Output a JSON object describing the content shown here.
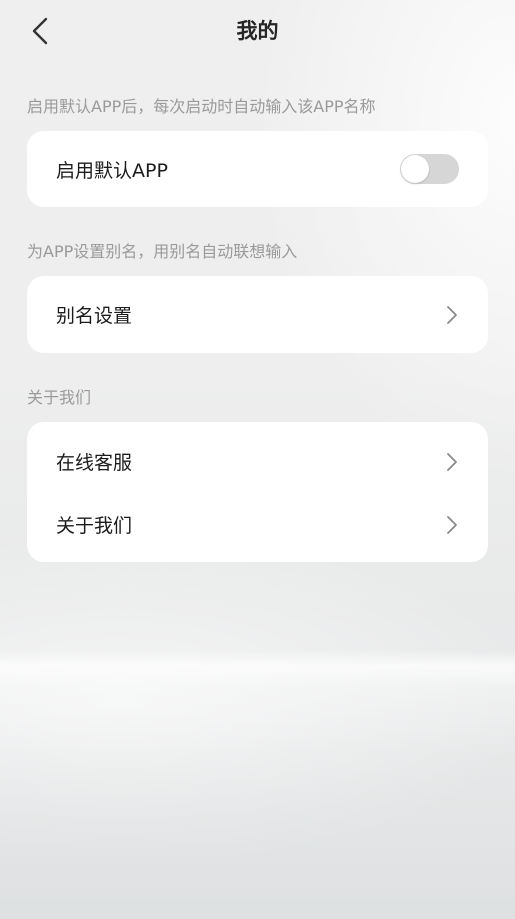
{
  "header": {
    "title": "我的",
    "back_icon": "chevron-left-icon"
  },
  "sections": [
    {
      "hint": "启用默认APP后，每次启动时自动输入该APP名称",
      "items": [
        {
          "label": "启用默认APP",
          "control": "toggle",
          "toggle_on": false
        }
      ]
    },
    {
      "hint": "为APP设置别名，用别名自动联想输入",
      "items": [
        {
          "label": "别名设置",
          "control": "chevron-right-icon"
        }
      ]
    },
    {
      "hint": "关于我们",
      "items": [
        {
          "label": "在线客服",
          "control": "chevron-right-icon"
        },
        {
          "label": "关于我们",
          "control": "chevron-right-icon"
        }
      ]
    }
  ],
  "colors": {
    "card_background": "#ffffff",
    "toggle_off": "#d6d6d6",
    "hint_text": "#9a9a9a",
    "chevron": "#8a8a8a"
  }
}
